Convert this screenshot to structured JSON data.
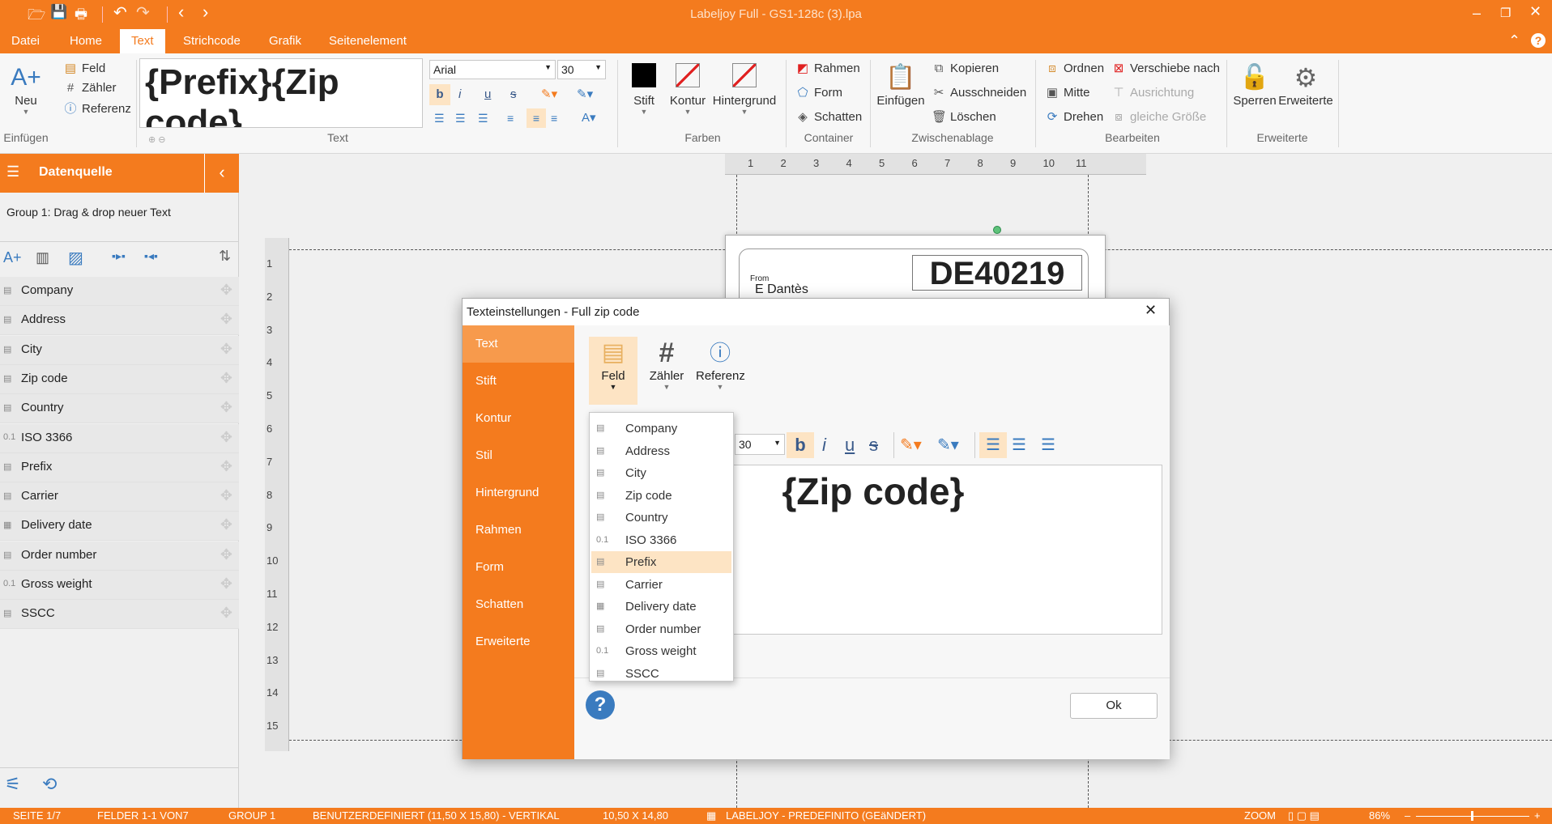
{
  "window": {
    "title": "Labeljoy Full - GS1-128c (3).lpa"
  },
  "menu": [
    "Datei",
    "Home",
    "Text",
    "Strichcode",
    "Grafik",
    "Seitenelement"
  ],
  "ribbon": {
    "einfuegen": {
      "neu": "Neu",
      "group": "Einfügen",
      "feld": "Feld",
      "zaehler": "Zähler",
      "referenz": "Referenz"
    },
    "text": {
      "preview": "{Prefix}{Zip code}",
      "font": "Arial",
      "size": "30",
      "group": "Text"
    },
    "farben": {
      "stift": "Stift",
      "kontur": "Kontur",
      "hintergrund": "Hintergrund",
      "group": "Farben"
    },
    "container": {
      "rahmen": "Rahmen",
      "form": "Form",
      "schatten": "Schatten",
      "group": "Container"
    },
    "zwischenablage": {
      "einfuegen": "Einfügen",
      "kopieren": "Kopieren",
      "ausschneiden": "Ausschneiden",
      "loeschen": "Löschen",
      "group": "Zwischenablage"
    },
    "bearbeiten": {
      "ordnen": "Ordnen",
      "mitte": "Mitte",
      "drehen": "Drehen",
      "verschiebe": "Verschiebe nach",
      "ausrichtung": "Ausrichtung",
      "gleiche": "gleiche Größe",
      "group": "Bearbeiten"
    },
    "erweiterte": {
      "sperren": "Sperren",
      "erweiterte": "Erweiterte",
      "group": "Erweiterte"
    }
  },
  "datasource": {
    "title": "Datenquelle",
    "group": "Group 1: Drag & drop neuer Text",
    "fields": [
      {
        "name": "Company",
        "icon": "doc"
      },
      {
        "name": "Address",
        "icon": "doc"
      },
      {
        "name": "City",
        "icon": "doc"
      },
      {
        "name": "Zip code",
        "icon": "doc"
      },
      {
        "name": "Country",
        "icon": "doc"
      },
      {
        "name": "ISO 3366",
        "icon": "num"
      },
      {
        "name": "Prefix",
        "icon": "doc"
      },
      {
        "name": "Carrier",
        "icon": "doc"
      },
      {
        "name": "Delivery date",
        "icon": "cal"
      },
      {
        "name": "Order number",
        "icon": "doc"
      },
      {
        "name": "Gross weight",
        "icon": "num"
      },
      {
        "name": "SSCC",
        "icon": "doc"
      }
    ]
  },
  "ruler": {
    "top": [
      "1",
      "2",
      "3",
      "4",
      "5",
      "6",
      "7",
      "8",
      "9",
      "10",
      "11"
    ],
    "left": [
      "1",
      "2",
      "3",
      "4",
      "5",
      "6",
      "7",
      "8",
      "9",
      "10",
      "11",
      "12",
      "13",
      "14",
      "15"
    ]
  },
  "label": {
    "from": "From",
    "sender": "E Dantès",
    "zip": "DE40219"
  },
  "dialog": {
    "title": "Texteinstellungen - Full zip code",
    "nav": [
      "Text",
      "Stift",
      "Kontur",
      "Stil",
      "Hintergrund",
      "Rahmen",
      "Form",
      "Schatten",
      "Erweiterte"
    ],
    "tools": {
      "feld": "Feld",
      "zaehler": "Zähler",
      "referenz": "Referenz"
    },
    "size": "30",
    "text": "{Zip code}",
    "ok": "Ok",
    "dropdown": [
      {
        "name": "Company",
        "icon": "doc"
      },
      {
        "name": "Address",
        "icon": "doc"
      },
      {
        "name": "City",
        "icon": "doc"
      },
      {
        "name": "Zip code",
        "icon": "doc"
      },
      {
        "name": "Country",
        "icon": "doc"
      },
      {
        "name": "ISO 3366",
        "icon": "num"
      },
      {
        "name": "Prefix",
        "icon": "doc",
        "highlight": true
      },
      {
        "name": "Carrier",
        "icon": "doc"
      },
      {
        "name": "Delivery date",
        "icon": "cal"
      },
      {
        "name": "Order number",
        "icon": "doc"
      },
      {
        "name": "Gross weight",
        "icon": "num"
      },
      {
        "name": "SSCC",
        "icon": "doc"
      }
    ]
  },
  "status": {
    "seite": "SEITE 1/7",
    "felder": "FELDER 1-1 VON7",
    "group": "GROUP 1",
    "format": "BENUTZERDEFINIERT (11,50 X 15,80) - VERTIKAL",
    "size": "10,50 X 14,80",
    "template": "LABELJOY - PREDEFINITO (GEäNDERT)",
    "zoom_label": "ZOOM",
    "zoom_value": "86%"
  },
  "colors": {
    "accent": "#f47b1e",
    "nav_active": "#f79a4c",
    "highlight": "#fde4c4"
  }
}
